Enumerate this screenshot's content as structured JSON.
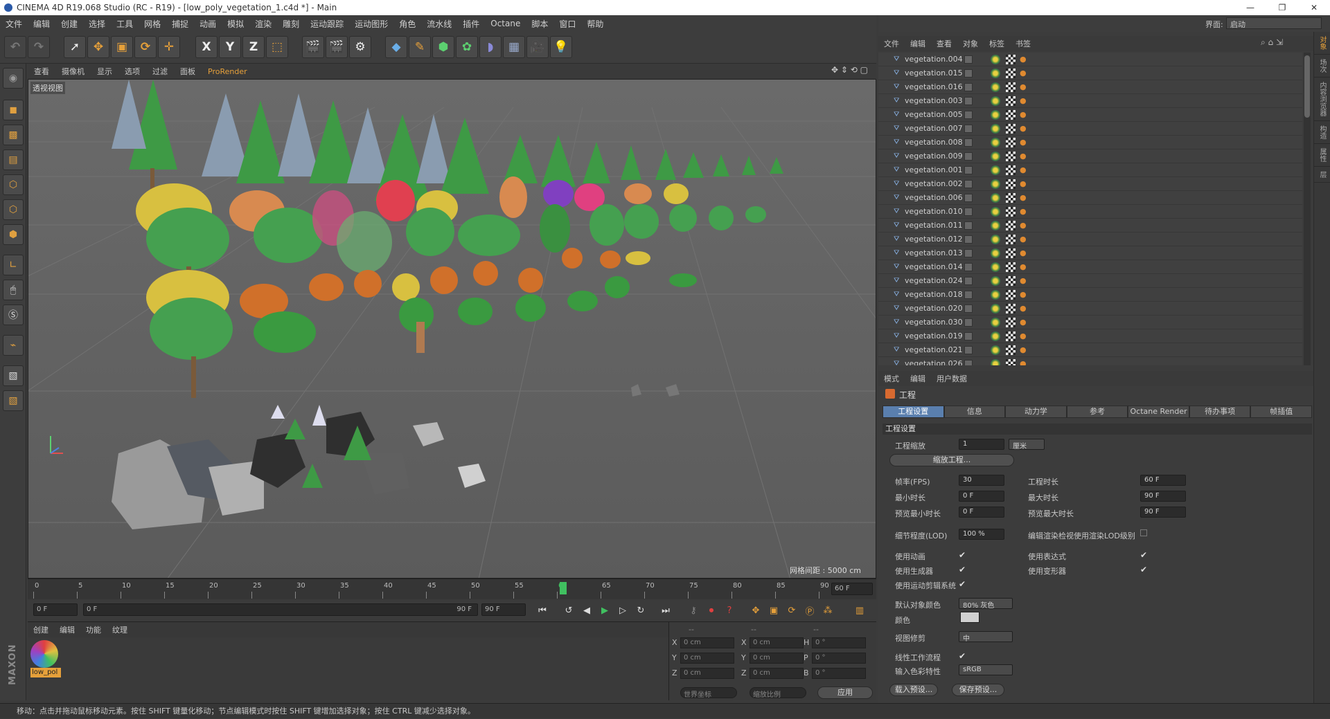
{
  "window": {
    "title": "CINEMA 4D R19.068 Studio (RC - R19) - [low_poly_vegetation_1.c4d *] - Main"
  },
  "menu": [
    "文件",
    "编辑",
    "创建",
    "选择",
    "工具",
    "网格",
    "捕捉",
    "动画",
    "模拟",
    "渲染",
    "雕刻",
    "运动跟踪",
    "运动图形",
    "角色",
    "流水线",
    "插件",
    "Octane",
    "脚本",
    "窗口",
    "帮助"
  ],
  "layout": {
    "label": "界面:",
    "value": "启动"
  },
  "toolbar": {
    "x": "X",
    "y": "Y",
    "z": "Z"
  },
  "viewport": {
    "menu": [
      "查看",
      "摄像机",
      "显示",
      "选项",
      "过滤",
      "面板",
      "ProRender"
    ],
    "label": "透视视图",
    "grid_info": "网格间距 : 5000 cm"
  },
  "timeline": {
    "ticks": [
      "0",
      "5",
      "10",
      "15",
      "20",
      "25",
      "30",
      "35",
      "40",
      "45",
      "50",
      "55",
      "60",
      "65",
      "70",
      "75",
      "80",
      "85",
      "90"
    ],
    "current": "60",
    "end_field": "60 F"
  },
  "transport": {
    "start": "0 F",
    "range_start": "0 F",
    "range_end": "90 F",
    "end": "90 F"
  },
  "material": {
    "menu": [
      "创建",
      "编辑",
      "功能",
      "纹理"
    ],
    "name": "low_pol"
  },
  "coords": {
    "headers": [
      "--",
      "--",
      "--"
    ],
    "rows": [
      {
        "a": "X",
        "av": "0 cm",
        "b": "X",
        "bv": "0 cm",
        "c": "H",
        "cv": "0 °"
      },
      {
        "a": "Y",
        "av": "0 cm",
        "b": "Y",
        "bv": "0 cm",
        "c": "P",
        "cv": "0 °"
      },
      {
        "a": "Z",
        "av": "0 cm",
        "b": "Z",
        "bv": "0 cm",
        "c": "B",
        "cv": "0 °"
      }
    ],
    "mode1": "世界坐标",
    "mode2": "缩放比例",
    "apply": "应用"
  },
  "status": "移动：点击并拖动鼠标移动元素。按住 SHIFT 键量化移动；节点编辑模式时按住 SHIFT 键增加选择对象；按住 CTRL 键减少选择对象。",
  "objects": {
    "menu": [
      "文件",
      "编辑",
      "查看",
      "对象",
      "标签",
      "书签"
    ],
    "items": [
      "vegetation.004",
      "vegetation.015",
      "vegetation.016",
      "vegetation.003",
      "vegetation.005",
      "vegetation.007",
      "vegetation.008",
      "vegetation.009",
      "vegetation.001",
      "vegetation.002",
      "vegetation.006",
      "vegetation.010",
      "vegetation.011",
      "vegetation.012",
      "vegetation.013",
      "vegetation.014",
      "vegetation.024",
      "vegetation.018",
      "vegetation.020",
      "vegetation.030",
      "vegetation.019",
      "vegetation.021",
      "vegetation.026"
    ]
  },
  "attributes": {
    "menu": [
      "模式",
      "编辑",
      "用户数据"
    ],
    "title": "工程",
    "tabs": [
      "工程设置",
      "信息",
      "动力学",
      "参考",
      "Octane Render",
      "待办事项",
      "帧插值"
    ],
    "section": "工程设置",
    "scale_label": "工程缩放",
    "scale_value": "1",
    "scale_unit": "厘米",
    "scale_button": "缩放工程...",
    "fps_label": "帧率(FPS)",
    "fps_value": "30",
    "duration_label": "工程时长",
    "duration_value": "60 F",
    "min_label": "最小时长",
    "min_value": "0 F",
    "max_label": "最大时长",
    "max_value": "90 F",
    "pmin_label": "预览最小时长",
    "pmin_value": "0 F",
    "pmax_label": "预览最大时长",
    "pmax_value": "90 F",
    "lod_label": "细节程度(LOD)",
    "lod_value": "100 %",
    "lod_render_label": "编辑渲染检视使用渲染LOD级别",
    "anim_label": "使用动画",
    "expr_label": "使用表达式",
    "gen_label": "使用生成器",
    "deform_label": "使用变形器",
    "motion_label": "使用运动剪辑系统",
    "objcolor_label": "默认对象颜色",
    "objcolor_value": "80% 灰色",
    "color_label": "颜色",
    "clip_label": "视图修剪",
    "clip_value": "中",
    "linear_label": "线性工作流程",
    "profile_label": "输入色彩特性",
    "profile_value": "sRGB",
    "load_button": "载入预设...",
    "save_button": "保存预设..."
  },
  "sidetabs": [
    "对象",
    "场次",
    "内容浏览器",
    "构造",
    "属性",
    "层"
  ],
  "logo": "MAXON CINEMA 4D",
  "colors": {
    "accent": "#e6a03a",
    "tab_active": "#5a7fae",
    "tree": "#3e9a45",
    "blue_tree": "#8a9cb0"
  }
}
